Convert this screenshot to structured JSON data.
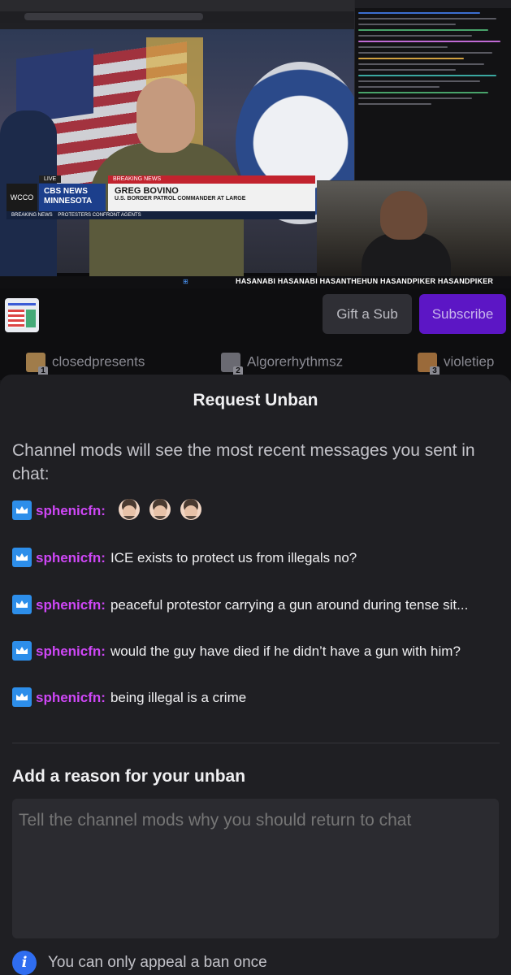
{
  "video": {
    "network_logo": "WCCO",
    "network_name": "CBS NEWS MINNESOTA",
    "live_label": "LIVE",
    "breaking_label": "BREAKING NEWS",
    "lower_third_name": "GREG BOVINO",
    "lower_third_title": "U.S. BORDER PATROL COMMANDER AT LARGE",
    "ticker_label": "BREAKING NEWS",
    "ticker_text": "PROTESTERS CONFRONT AGENTS",
    "social_handles": "HASANABI  HASANABI  HASANTHEHUN  HASANDPIKER  HASANDPIKER"
  },
  "channel": {
    "gift_label": "Gift a Sub",
    "subscribe_label": "Subscribe"
  },
  "leaderboard": [
    {
      "name": "closedpresents",
      "rank": "1"
    },
    {
      "name": "Algorerhythmsz",
      "rank": "2"
    },
    {
      "name": "violetiep",
      "rank": "3"
    }
  ],
  "sheet": {
    "title": "Request Unban",
    "intro": "Channel mods will see the most recent messages you sent in chat:",
    "messages": [
      {
        "user": "sphenicfn:",
        "text": ""
      },
      {
        "user": "sphenicfn:",
        "text": "ICE exists to protect us from illegals no?"
      },
      {
        "user": "sphenicfn:",
        "text": "peaceful protestor carrying a gun around during tense sit..."
      },
      {
        "user": "sphenicfn:",
        "text": "would the guy have died if he didn’t have a gun with him?"
      },
      {
        "user": "sphenicfn:",
        "text": "being illegal is a crime"
      }
    ],
    "reason_heading": "Add a reason for your unban",
    "reason_placeholder": "Tell the channel mods why you should return to chat",
    "note": "You can only appeal a ban once"
  },
  "colors": {
    "accent_purple": "#5c16c5",
    "username": "#ce47f6",
    "badge_blue": "#2d8eea",
    "info_blue": "#2f6df0"
  }
}
